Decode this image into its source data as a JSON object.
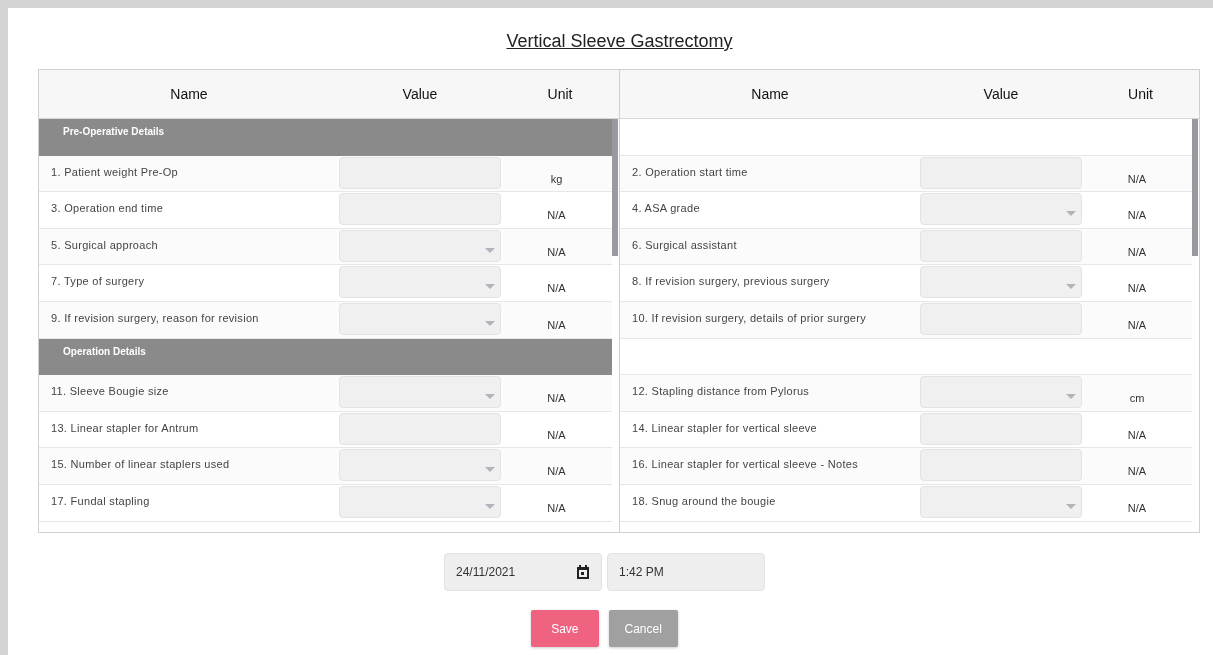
{
  "title": "Vertical Sleeve Gastrectomy",
  "tables": [
    {
      "columns": [
        "Name",
        "Value",
        "Unit"
      ],
      "rows": [
        {
          "kind": "section",
          "label": "Pre-Operative Details"
        },
        {
          "kind": "text_field",
          "name": "1. Patient weight Pre-Op",
          "unit": "kg"
        },
        {
          "kind": "text_field",
          "name": "3. Operation end time",
          "unit": "N/A"
        },
        {
          "kind": "select_field",
          "name": "5. Surgical approach",
          "unit": "N/A"
        },
        {
          "kind": "select_field",
          "name": "7. Type of surgery",
          "unit": "N/A"
        },
        {
          "kind": "select_field",
          "name": "9. If revision surgery, reason for revision",
          "unit": "N/A"
        },
        {
          "kind": "section",
          "label": "Operation Details"
        },
        {
          "kind": "select_field",
          "name": "11. Sleeve Bougie size",
          "unit": "N/A"
        },
        {
          "kind": "text_field",
          "name": "13. Linear stapler for Antrum",
          "unit": "N/A"
        },
        {
          "kind": "select_field",
          "name": "15. Number of linear staplers used",
          "unit": "N/A"
        },
        {
          "kind": "select_field",
          "name": "17. Fundal stapling",
          "unit": "N/A"
        }
      ]
    },
    {
      "columns": [
        "Name",
        "Value",
        "Unit"
      ],
      "rows": [
        {
          "kind": "blank"
        },
        {
          "kind": "text_field",
          "name": "2. Operation start time",
          "unit": "N/A"
        },
        {
          "kind": "select_field",
          "name": "4. ASA grade",
          "unit": "N/A"
        },
        {
          "kind": "text_field",
          "name": "6. Surgical assistant",
          "unit": "N/A"
        },
        {
          "kind": "select_field",
          "name": "8. If revision surgery, previous surgery",
          "unit": "N/A"
        },
        {
          "kind": "text_field",
          "name": "10. If revision surgery, details of prior surgery",
          "unit": "N/A"
        },
        {
          "kind": "blank"
        },
        {
          "kind": "select_field",
          "name": "12. Stapling distance from Pylorus",
          "unit": "cm"
        },
        {
          "kind": "text_field",
          "name": "14. Linear stapler for vertical sleeve",
          "unit": "N/A"
        },
        {
          "kind": "text_field",
          "name": "16. Linear stapler for vertical sleeve - Notes",
          "unit": "N/A"
        },
        {
          "kind": "select_field",
          "name": "18. Snug around the bougie",
          "unit": "N/A"
        }
      ]
    }
  ],
  "date": {
    "value": "24/11/2021"
  },
  "time": {
    "value": "1:42 PM"
  },
  "buttons": [
    {
      "label": "Save",
      "kind": "primary"
    },
    {
      "label": "Cancel",
      "kind": "secondary"
    }
  ]
}
